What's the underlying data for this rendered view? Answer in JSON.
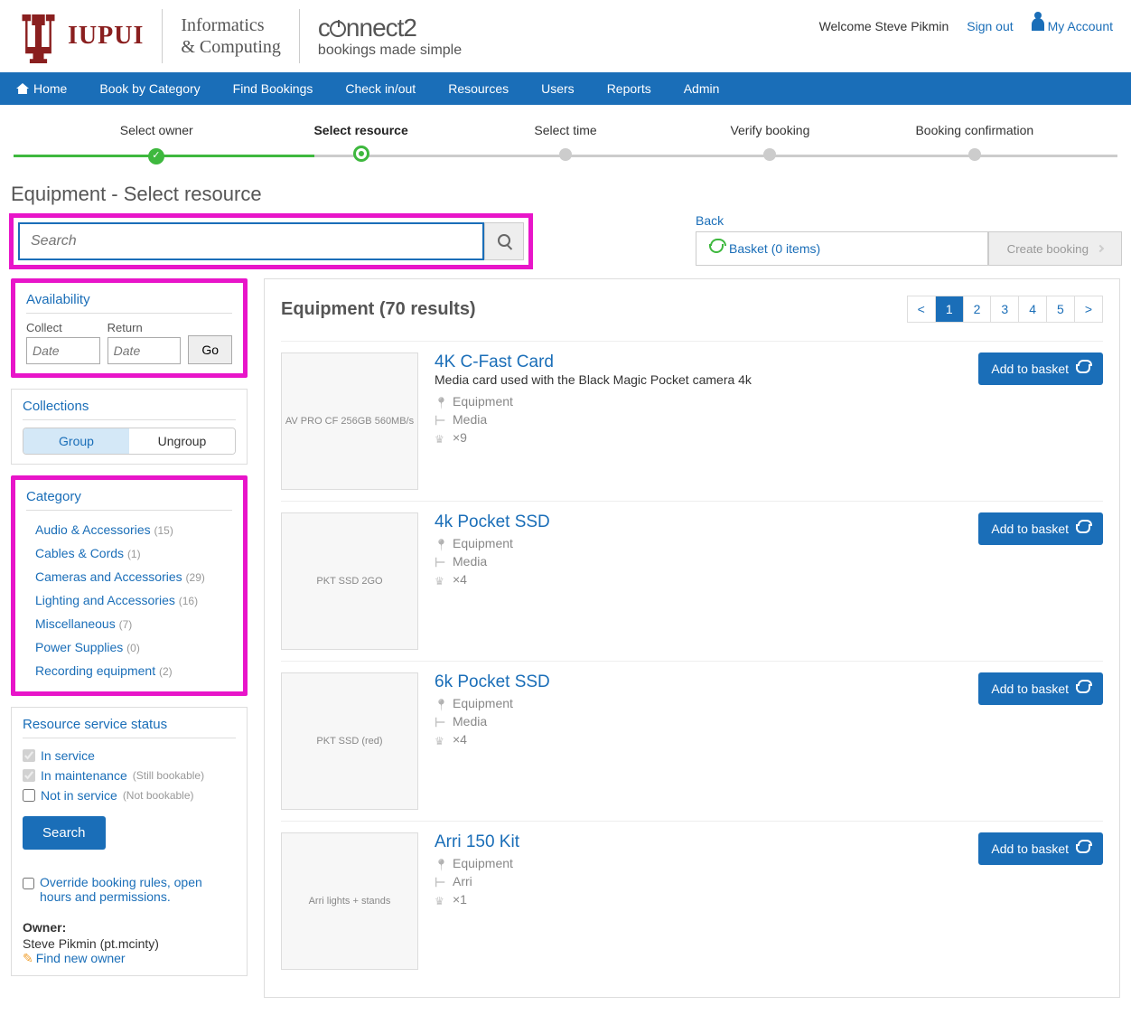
{
  "header": {
    "welcome": "Welcome Steve Pikmin",
    "sign_out": "Sign out",
    "my_account": "My Account",
    "sublogo_line1": "Informatics",
    "sublogo_line2": "& Computing",
    "brand_line2": "bookings made simple"
  },
  "nav": {
    "home": "Home",
    "book_by_category": "Book by Category",
    "find_bookings": "Find Bookings",
    "check_in_out": "Check in/out",
    "resources": "Resources",
    "users": "Users",
    "reports": "Reports",
    "admin": "Admin"
  },
  "steps": {
    "select_owner": "Select owner",
    "select_resource": "Select resource",
    "select_time": "Select time",
    "verify_booking": "Verify booking",
    "booking_confirmation": "Booking confirmation"
  },
  "page_title": "Equipment - Select resource",
  "search": {
    "placeholder": "Search"
  },
  "actions": {
    "back": "Back",
    "basket": "Basket (0 items)",
    "create_booking": "Create booking"
  },
  "availability": {
    "title": "Availability",
    "collect_label": "Collect",
    "return_label": "Return",
    "date_placeholder": "Date",
    "go": "Go"
  },
  "collections": {
    "title": "Collections",
    "group": "Group",
    "ungroup": "Ungroup"
  },
  "category": {
    "title": "Category",
    "items": [
      {
        "label": "Audio & Accessories",
        "count": "(15)"
      },
      {
        "label": "Cables & Cords",
        "count": "(1)"
      },
      {
        "label": "Cameras and Accessories",
        "count": "(29)"
      },
      {
        "label": "Lighting and Accessories",
        "count": "(16)"
      },
      {
        "label": "Miscellaneous",
        "count": "(7)"
      },
      {
        "label": "Power Supplies",
        "count": "(0)"
      },
      {
        "label": "Recording equipment",
        "count": "(2)"
      }
    ]
  },
  "status": {
    "title": "Resource service status",
    "in_service": "In service",
    "in_maintenance": "In maintenance",
    "in_maintenance_note": "(Still bookable)",
    "not_in_service": "Not in service",
    "not_in_service_note": "(Not bookable)",
    "search_btn": "Search",
    "override": "Override booking rules, open hours and permissions.",
    "owner_label": "Owner:",
    "owner_name": "Steve Pikmin (pt.mcinty)",
    "find_new_owner": "Find new owner"
  },
  "results": {
    "title": "Equipment (70 results)",
    "pager": {
      "prev": "<",
      "p1": "1",
      "p2": "2",
      "p3": "3",
      "p4": "4",
      "p5": "5",
      "next": ">"
    },
    "add_label": "Add to basket",
    "items": [
      {
        "title": "4K C-Fast Card",
        "desc": "Media card used with the Black Magic Pocket camera 4k",
        "loc": "Equipment",
        "cat": "Media",
        "qty": "×9",
        "thumb": "AV PRO CF 256GB 560MB/s"
      },
      {
        "title": "4k Pocket SSD",
        "desc": "",
        "loc": "Equipment",
        "cat": "Media",
        "qty": "×4",
        "thumb": "PKT SSD 2GO"
      },
      {
        "title": "6k Pocket SSD",
        "desc": "",
        "loc": "Equipment",
        "cat": "Media",
        "qty": "×4",
        "thumb": "PKT SSD (red)"
      },
      {
        "title": "Arri 150 Kit",
        "desc": "",
        "loc": "Equipment",
        "cat": "Arri",
        "qty": "×1",
        "thumb": "Arri lights + stands"
      }
    ]
  }
}
